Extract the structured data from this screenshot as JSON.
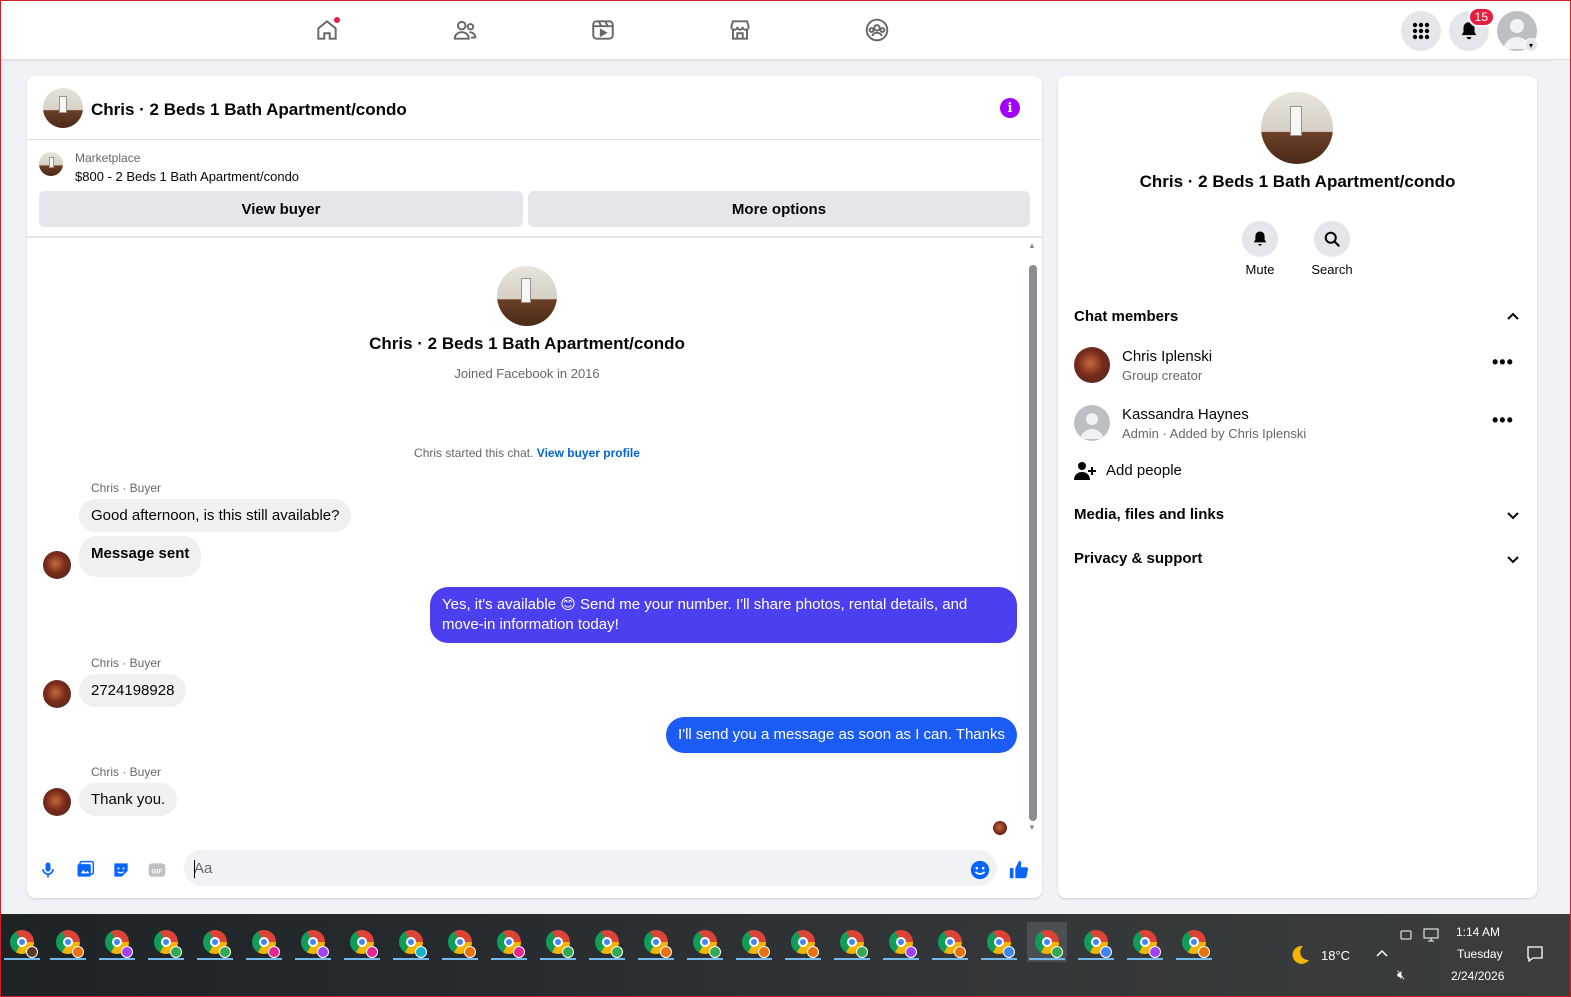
{
  "topnav": {
    "icons": [
      "home-icon",
      "friends-icon",
      "video-icon",
      "marketplace-icon",
      "groups-icon"
    ],
    "notification_count": "15",
    "accent_color": "#e41e3f"
  },
  "chat": {
    "title": "Chris · 2 Beds 1 Bath Apartment/condo",
    "listing": {
      "label": "Marketplace",
      "price_title": "$800 - 2 Beds 1 Bath Apartment/condo"
    },
    "view_buyer_label": "View buyer",
    "more_options_label": "More options",
    "profile": {
      "name": "Chris · 2 Beds 1 Bath Apartment/condo",
      "joined": "Joined Facebook in 2016"
    },
    "started_text": "Chris started this chat.",
    "started_link": "View buyer profile",
    "messages": [
      {
        "sender": "Chris · Buyer",
        "text": "Good afternoon, is this still available?"
      },
      {
        "text": "Message sent"
      },
      {
        "text": "Yes, it's available 😊 Send me your number. I'll share photos, rental details, and move-in information today!"
      },
      {
        "sender": "Chris · Buyer",
        "text": "2724198928"
      },
      {
        "text": "I'll send you a message as soon as I can. Thanks"
      },
      {
        "sender": "Chris · Buyer",
        "text": "Thank you."
      }
    ],
    "composer_placeholder": "Aa",
    "outgoing_colors": [
      "#4b3ff0",
      "#1a5cf5"
    ]
  },
  "details": {
    "name": "Chris · 2 Beds 1 Bath Apartment/condo",
    "mute_label": "Mute",
    "search_label": "Search",
    "chat_members_label": "Chat members",
    "members": [
      {
        "name": "Chris Iplenski",
        "role": "Group creator"
      },
      {
        "name": "Kassandra Haynes",
        "role": "Admin · Added by Chris Iplenski"
      }
    ],
    "add_people_label": "Add people",
    "media_label": "Media, files and links",
    "privacy_label": "Privacy & support"
  },
  "taskbar": {
    "weather": "18°C",
    "time": "1:14 AM",
    "day": "Tuesday",
    "date": "2/24/2026",
    "app_icons": "chrome-icon"
  }
}
